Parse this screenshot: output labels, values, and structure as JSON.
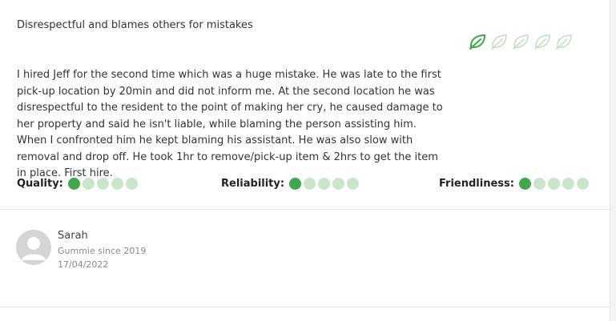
{
  "review": {
    "title": "Disrespectful and blames others for mistakes",
    "leaf_rating": {
      "value": 1,
      "max": 5,
      "icon": "leaf-icon",
      "color_on": "#3ea84a",
      "color_off": "#b7dfba"
    },
    "body": "I hired Jeff for the second time which was a huge mistake. He was late to the first pick-up location by 20min and did not inform me. At the second location he was disrespectful to the resident to the point of making her cry, he caused damage to her property and said he isn't liable, while blaming the person assisting him. When I confronted him he kept blaming his assistant. He was also slow with removal and drop off. He took 1hr to remove/pick-up item & 2hrs to get the item in place. First hire."
  },
  "ratings": [
    {
      "label": "Quality:",
      "value": 1,
      "max": 5
    },
    {
      "label": "Reliability:",
      "value": 1,
      "max": 5
    },
    {
      "label": "Friendliness:",
      "value": 1,
      "max": 5
    }
  ],
  "reviewer": {
    "name": "Sarah",
    "since": "Gummie since 2019",
    "date": "17/04/2022",
    "avatar_icon": "user-avatar-icon"
  },
  "colors": {
    "accent_green": "#3ea84a",
    "inactive_green": "#c8e6c9"
  }
}
